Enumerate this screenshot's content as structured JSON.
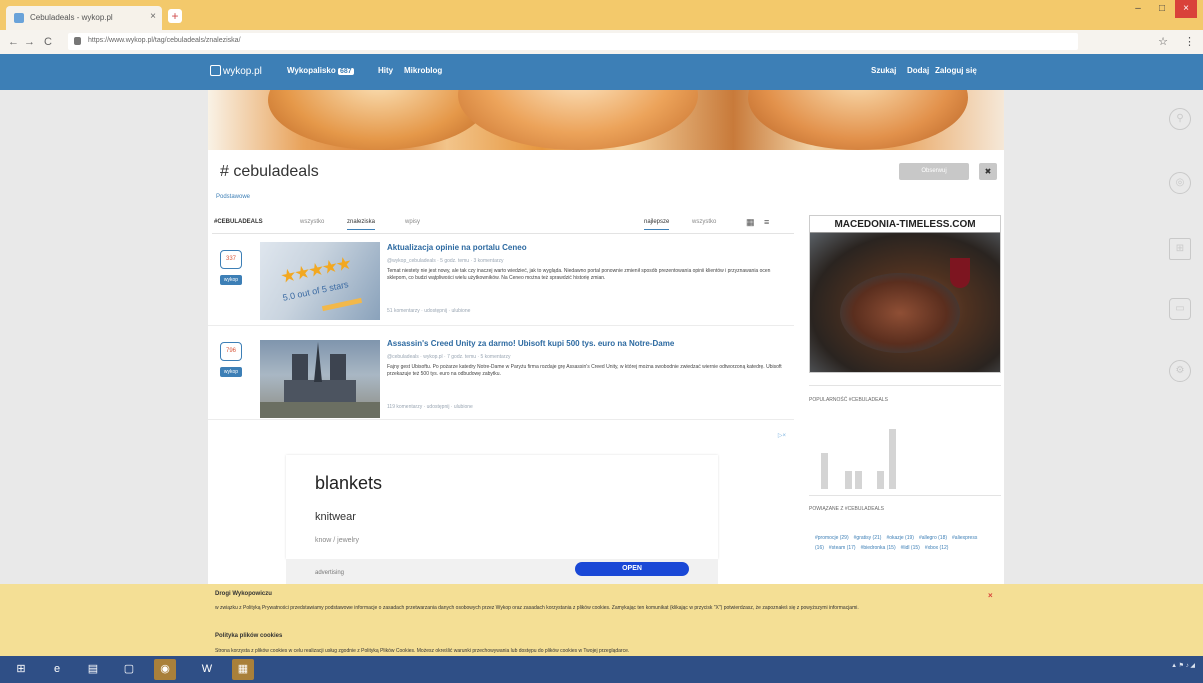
{
  "browser": {
    "tab_title": "Cebuladeals - wykop.pl",
    "tab_close": "×",
    "new_tab": "+",
    "url": "https://www.wykop.pl/tag/cebuladeals/znaleziska/",
    "win_min": "–",
    "win_max": "□",
    "win_close": "×",
    "back": "←",
    "forward": "→",
    "reload": "C",
    "star_icon": "☆",
    "menu_icon": "⋮"
  },
  "sitenav": {
    "logo": "wykop.pl",
    "items": [
      {
        "label": "Wykopalisko",
        "count": "687"
      },
      {
        "label": "Hity"
      },
      {
        "label": "Mikroblog"
      }
    ],
    "right": [
      "Szukaj",
      "Dodaj",
      "Zaloguj się"
    ]
  },
  "tag": {
    "title": "# cebuladeals",
    "subtitle": "Podstawowe",
    "follow_label": "Obserwuj",
    "block_label": "✖"
  },
  "filters": {
    "label": "#CEBULADEALS",
    "tabs": [
      "wszystko",
      "znaleziska",
      "wpisy"
    ],
    "active_tab": "znaleziska",
    "sort": [
      "najlepsze",
      "wszystko"
    ],
    "view_icons": [
      "▦",
      "≡"
    ]
  },
  "entries": [
    {
      "votes": "337",
      "wykop_label": "wykop",
      "title": "Aktualizacja opinie na portalu Ceneo",
      "meta": "@wykop_cebuladeals  ·  5 godz. temu  ·  3 komentarzy",
      "desc": "Temat niestety nie jest nowy, ale tak czy inaczej warto wiedzieć, jak to wygląda. Niedawno portal ponownie zmienił sposób prezentowania opinii klientów i przyznawania ocen sklepom, co budzi wątpliwości wielu użytkowników. Na Ceneo można też sprawdzić historię zmian.",
      "foot": "51 komentarzy  ·  udostępnij  ·  ulubione"
    },
    {
      "votes": "796",
      "wykop_label": "wykop",
      "title": "Assassin's Creed Unity za darmo! Ubisoft kupi 500 tys. euro na Notre-Dame",
      "meta": "@cebuladeals  ·  wykop.pl  ·  7 godz. temu  ·  5 komentarzy",
      "desc": "Fajny gest Ubisoftu. Po pożarze katedry Notre-Dame w Paryżu firma rozdaje grę Assassin's Creed Unity, w której można swobodnie zwiedzać wiernie odtworzoną katedrę. Ubisoft przekazuje też 500 tys. euro na odbudowę zabytku.",
      "foot": "119 komentarzy  ·  udostępnij  ·  ulubione"
    }
  ],
  "ad": {
    "adchoice": "▷×",
    "title": "blankets",
    "subtitle": "knitwear",
    "sub": "know / jewelry",
    "domain": "advertising",
    "open": "OPEN"
  },
  "sidebar": {
    "ad_title": "MACEDONIA-TIMELESS.COM",
    "activity_heading": "POPULARNOŚĆ #CEBULADEALS",
    "activity_bars": [
      0.6,
      0.3,
      0.3,
      0.3,
      1.0
    ],
    "related_heading": "POWIĄZANE Z #CEBULADEALS",
    "related_tags": [
      "#promocje (29)",
      "#gratisy (21)",
      "#okazje (19)",
      "#allegro (18)",
      "#aliexpress (16)",
      "#steam (17)",
      "#biedronka (15)",
      "#lidl (15)",
      "#xbox (12)"
    ]
  },
  "cookie": {
    "heading": "Drogi Wykopowiczu",
    "body": "w związku z Polityką Prywatności przedstawiamy podstawowe informacje o zasadach przetwarzania danych osobowych przez Wykop oraz zasadach korzystania z plików cookies. Zamykając ten komunikat (klikając w przycisk \"X\") potwierdzasz, że zapoznałeś się z powyższymi informacjami.",
    "heading2": "Polityka plików cookies",
    "body2": "Strona korzysta z plików cookies w celu realizacji usług zgodnie z Polityką Plików Cookies. Możesz określić warunki przechowywania lub dostępu do plików cookies w Twojej przeglądarce.",
    "close": "×"
  },
  "side_icons": [
    "search-icon",
    "globe-icon",
    "windows-icon",
    "device-icon",
    "gear-icon"
  ],
  "colors": {
    "accent": "#3d7fb6",
    "cookie_bg": "#f4df95",
    "chrome": "#f1c55e",
    "taskbar": "#2f4f86"
  }
}
